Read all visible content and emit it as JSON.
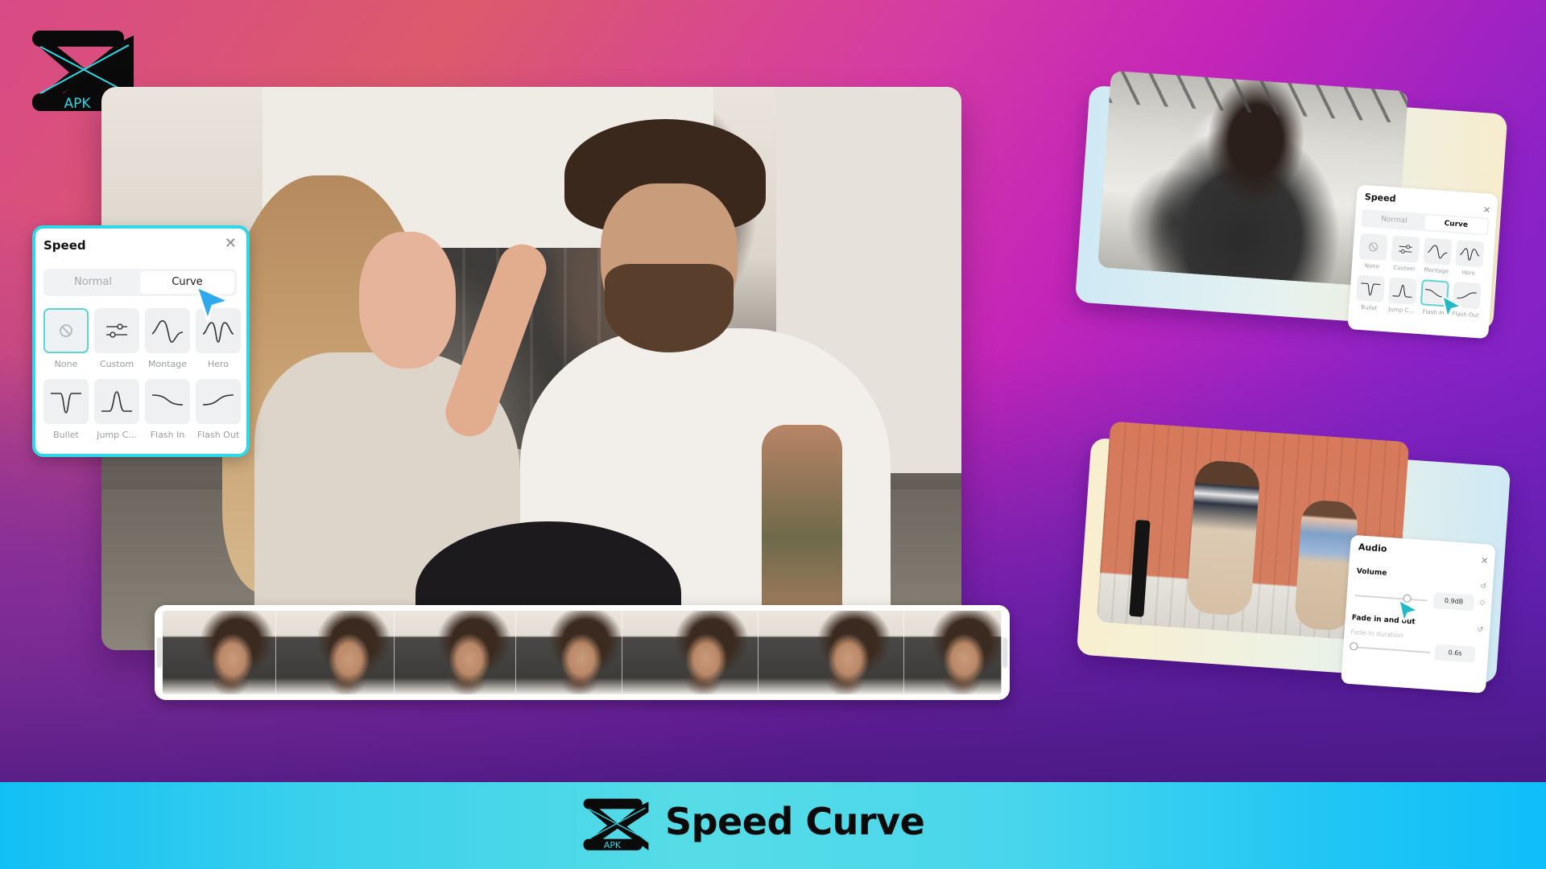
{
  "brand": {
    "logo_text": "APK",
    "logo_icon": "capcut-logo-icon",
    "accent_color": "#2fd8e6"
  },
  "main_preview": {
    "description": "Father and daughter in kitchen video preview"
  },
  "speed_panel": {
    "title": "Speed",
    "close_icon": "close-icon",
    "tabs": [
      {
        "label": "Normal",
        "active": false
      },
      {
        "label": "Curve",
        "active": true
      }
    ],
    "presets": [
      {
        "label": "None",
        "icon": "none-icon",
        "selected": true
      },
      {
        "label": "Custom",
        "icon": "sliders-icon",
        "selected": false
      },
      {
        "label": "Montage",
        "icon": "montage-curve-icon",
        "selected": false
      },
      {
        "label": "Hero",
        "icon": "hero-curve-icon",
        "selected": false
      },
      {
        "label": "Bullet",
        "icon": "bullet-curve-icon",
        "selected": false
      },
      {
        "label": "Jump C...",
        "icon": "jump-cut-curve-icon",
        "selected": false
      },
      {
        "label": "Flash In",
        "icon": "flash-in-curve-icon",
        "selected": false
      },
      {
        "label": "Flash Out",
        "icon": "flash-out-curve-icon",
        "selected": false
      }
    ]
  },
  "filmstrip": {
    "frame_count": 7
  },
  "card_speed": {
    "title": "Speed",
    "tabs": [
      {
        "label": "Normal",
        "active": false
      },
      {
        "label": "Curve",
        "active": true
      }
    ],
    "presets": [
      {
        "label": "None",
        "selected": false
      },
      {
        "label": "Custom",
        "selected": false
      },
      {
        "label": "Montage",
        "selected": false
      },
      {
        "label": "Hero",
        "selected": false
      },
      {
        "label": "Bullet",
        "selected": false
      },
      {
        "label": "Jump C...",
        "selected": false
      },
      {
        "label": "Flash In",
        "selected": true
      },
      {
        "label": "Flash Out",
        "selected": false
      }
    ]
  },
  "card_audio": {
    "title": "Audio",
    "volume_label": "Volume",
    "volume_value": "0.9dB",
    "volume_level": 0.72,
    "fade_label": "Fade in and out",
    "fade_in_label": "Fade-in duration",
    "fade_in_value": "0.6s",
    "fade_in_level": 0.05
  },
  "banner": {
    "title": "Speed Curve",
    "logo_text": "APK"
  }
}
